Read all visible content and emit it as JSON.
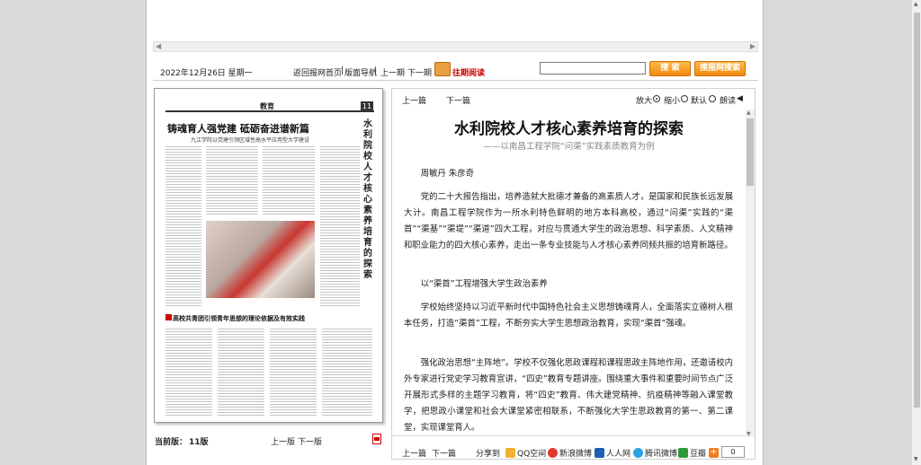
{
  "topbar": {
    "date": "2022年12月26日 星期一",
    "home_link": "返回报网首页",
    "nav_link": "版面导航",
    "prev_issue": "上一期",
    "next_issue": "下一期",
    "history": "往期阅读",
    "search_button": "搜 索",
    "site_search_button": "搜报网搜索",
    "search_value": ""
  },
  "newspaper": {
    "page_label": "11",
    "section": "教育",
    "headline": "铸魂育人强党建  砥砺奋进谱新篇",
    "subheadline": "九江学院以党建引领区域性高水平应用型大学建设",
    "vertical_title": "水利院校人才核心素养培育的探索",
    "second_headline": "高校共青团引领青年思想的理论依据及有效实践"
  },
  "page_footer": {
    "current_label": "当前版：",
    "current_value": "11版",
    "prev": "上一版",
    "next": "下一版"
  },
  "article": {
    "prev": "上一篇",
    "next": "下一篇",
    "zoom_in": "放大",
    "zoom_out": "缩小",
    "default": "默认",
    "read_aloud": "朗读",
    "title": "水利院校人才核心素养培育的探索",
    "subtitle": "——以南昌工程学院“问渠”实践素质教育为例",
    "paragraphs": [
      "周敏丹 朱彦奇",
      "党的二十大报告指出，培养造就大批德才兼备的高素质人才，是国家和民族长远发展大计。南昌工程学院作为一所水利特色鲜明的地方本科高校，通过“问渠”实践的“渠首”“渠基”“渠堤”“渠道”四大工程，对应与贯通大学生的政治思想、科学素质、人文精神和职业能力的四大核心素养，走出一条专业技能与人才核心素养同频共振的培育新路径。",
      "以“渠首”工程增强大学生政治素养",
      "学校始终坚持以习近平新时代中国特色社会主义思想铸魂育人，全面落实立德树人根本任务，打造“渠首”工程，不断夯实大学生思想政治教育，实现“渠首”强魂。",
      "强化政治思想“主阵地”。学校不仅强化思政课程和课程思政主阵地作用，还邀请校内外专家进行党史学习教育宣讲，“四史”教育专题讲座。围绕重大事件和重要时间节点广泛开展形式多样的主题学习教育，将“四史”教育、伟大建党精神、抗疫精神等融入课堂教学，把思政小课堂和社会大课堂紧密相联系，不断强化大学生思政教育的第一、第二课堂，实现课堂育人。"
    ],
    "share_label": "分享到",
    "share_items": [
      "QQ空间",
      "新浪微博",
      "人人网",
      "腾讯微博",
      "豆瓣"
    ],
    "share_count": "0"
  },
  "colors": {
    "accent_orange": "#ee8a10",
    "history_red": "#cc0000"
  }
}
